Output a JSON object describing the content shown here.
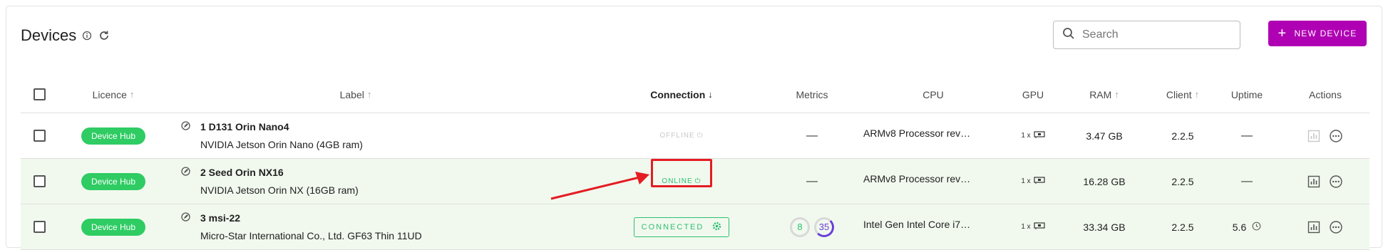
{
  "header": {
    "title": "Devices",
    "info_icon": "info-icon",
    "refresh_icon": "refresh-icon"
  },
  "search": {
    "placeholder": "Search",
    "value": ""
  },
  "new_device_button": {
    "label": "NEW DEVICE",
    "plus": "+"
  },
  "columns": {
    "licence": "Licence",
    "label": "Label",
    "connection": "Connection",
    "metrics": "Metrics",
    "cpu": "CPU",
    "gpu": "GPU",
    "ram": "RAM",
    "client": "Client",
    "uptime": "Uptime",
    "actions": "Actions"
  },
  "rows": [
    {
      "licence": "Device Hub",
      "name": "1 D131 Orin Nano4",
      "description": "NVIDIA Jetson Orin Nano (4GB ram)",
      "connection": "OFFLINE",
      "metrics": "—",
      "cpu": "ARMv8 Processor rev…",
      "gpu_count": "1 x",
      "ram": "3.47 GB",
      "client": "2.2.5",
      "uptime": "—"
    },
    {
      "licence": "Device Hub",
      "name": "2 Seed Orin NX16",
      "description": "NVIDIA Jetson Orin NX (16GB ram)",
      "connection": "ONLINE",
      "metrics": "—",
      "cpu": "ARMv8 Processor rev…",
      "gpu_count": "1 x",
      "ram": "16.28 GB",
      "client": "2.2.5",
      "uptime": "—"
    },
    {
      "licence": "Device Hub",
      "name": "3 msi-22",
      "description": "Micro-Star International Co., Ltd. GF63 Thin 11UD",
      "connection": "CONNECTED",
      "metric_cpu": "8",
      "metric_ram": "35",
      "cpu": "Intel Gen Intel Core i7…",
      "gpu_count": "1 x",
      "ram": "33.34 GB",
      "client": "2.2.5",
      "uptime": "5.6"
    }
  ],
  "colors": {
    "accent": "#b000b4",
    "chip_green": "#2ecc63",
    "status_green": "#2ebf71",
    "row_highlight": "#f1f9ee",
    "annotation_red": "#e51c23"
  }
}
